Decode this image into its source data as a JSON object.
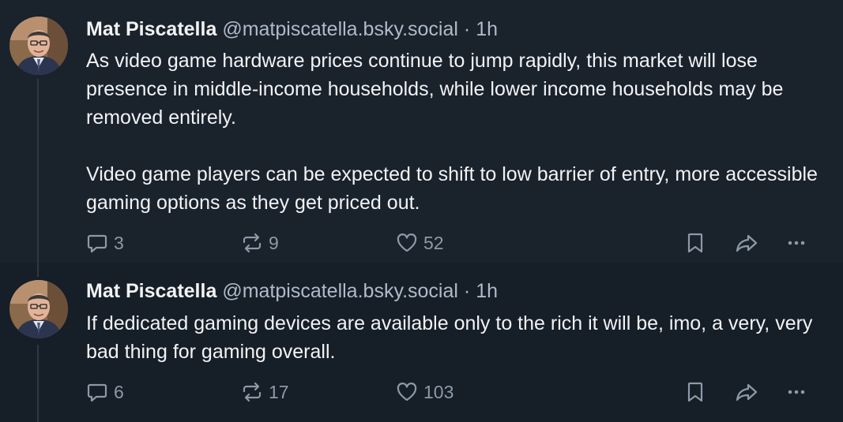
{
  "posts": [
    {
      "author": {
        "display_name": "Mat Piscatella",
        "handle": "@matpiscatella.bsky.social",
        "avatar_icon": "avatar-photo"
      },
      "separator": "·",
      "timestamp": "1h",
      "paragraphs": [
        "As video game hardware prices continue to jump rapidly, this market will lose presence in middle-income households, while lower income households may be removed entirely.",
        "Video game players can be expected to shift to low barrier of entry, more accessible gaming options as they get priced out."
      ],
      "counts": {
        "replies": "3",
        "reposts": "9",
        "likes": "52"
      }
    },
    {
      "author": {
        "display_name": "Mat Piscatella",
        "handle": "@matpiscatella.bsky.social",
        "avatar_icon": "avatar-photo"
      },
      "separator": "·",
      "timestamp": "1h",
      "paragraphs": [
        "If dedicated gaming devices are available only to the rich it will be, imo, a very, very bad thing for gaming overall."
      ],
      "counts": {
        "replies": "6",
        "reposts": "17",
        "likes": "103"
      }
    }
  ],
  "action_icons": [
    "reply-icon",
    "repost-icon",
    "like-icon",
    "bookmark-icon",
    "share-icon",
    "more-icon"
  ],
  "colors": {
    "background": "#161e27",
    "highlight_background": "#1a222c",
    "text": "#f1f3f5",
    "muted": "#aebbc9",
    "icon": "#8c9aa8",
    "thread_line": "#2e3844"
  }
}
